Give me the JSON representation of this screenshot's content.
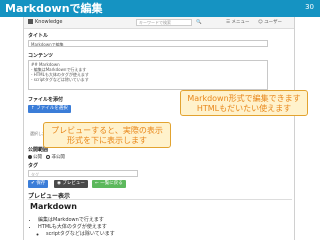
{
  "slide": {
    "title": "Markdownで編集",
    "page_number": "30"
  },
  "app": {
    "brand": "Knowledge",
    "brand_badge": "ααααα",
    "search_placeholder": "キーワードで検索",
    "nav_search_icon": "search-icon",
    "nav_menu_label": "メニュー",
    "nav_user_label": "ユーザー"
  },
  "form": {
    "title_label": "タイトル",
    "title_value": "Markdownで編集",
    "content_label": "コンテンツ",
    "content_lines": [
      "## Markdown",
      "- 編集はMarkdownで行えます",
      "- HTMLも大体のタグが使えます",
      "  - scriptタグなどは除いています"
    ],
    "attach_label": "ファイルを添付",
    "attach_button": "ファイルを選択",
    "tag_hint": "選択したファイルでアップロードされます。（最大サイズ）",
    "visibility_label": "公開範囲",
    "visibility_options": [
      "公開",
      "非公開",
      "保護"
    ],
    "tag_label": "タグ",
    "tag_placeholder": "タグ"
  },
  "actions": {
    "save": "保存",
    "preview": "プレビュー",
    "back": "一覧に戻る"
  },
  "preview": {
    "heading": "プレビュー表示",
    "title": "Markdown",
    "items": [
      "編集はMarkdownで行えます",
      "HTMLも大体のタグが使えます"
    ],
    "sub_items": [
      "scriptタグなどは除いています"
    ]
  },
  "callouts": {
    "markdown_lines": [
      "Markdown形式で編集できます",
      "HTMLもだいたい使えます"
    ],
    "preview_lines": [
      "プレビューすると、実際の表示",
      "形式を下に表示します"
    ]
  },
  "colors": {
    "header": "#1593c2",
    "callout_bg": "#fff2cc",
    "callout_text": "#e8871a"
  }
}
